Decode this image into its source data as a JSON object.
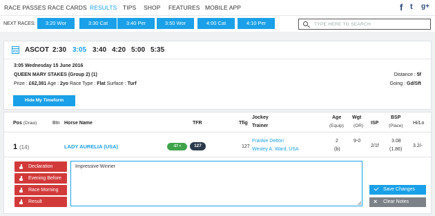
{
  "nav": {
    "items": [
      "RACE PASSES",
      "RACE CARDS",
      "RESULTS",
      "TIPS",
      "SHOP",
      "FEATURES",
      "MOBILE APP"
    ],
    "active": "RESULTS",
    "social": [
      "f",
      "t",
      "g+"
    ]
  },
  "next_races": {
    "label": "NEXT RACES:",
    "races": [
      "3:20 Wor",
      "3:30 Cat",
      "3:40 Per",
      "3:50 Wor",
      "4:00 Cat",
      "4:10 Per"
    ]
  },
  "search": {
    "placeholder": "TYPE HERE TO SEARCH"
  },
  "meeting": {
    "venue": "ASCOT",
    "times": [
      "2:30",
      "3:05",
      "3:40",
      "4:20",
      "5:00",
      "5:35"
    ],
    "active_time": "3:05"
  },
  "race": {
    "datetime": "3:05 Wednesday 15 June 2016",
    "name": "QUEEN MARY STAKES (Group 2) (1)",
    "prize_label": "Prize :",
    "prize": "£62,381",
    "age_label": "Age :",
    "age": "2yo",
    "type_label": "Race Type :",
    "type": "Flat",
    "surface_label": "Surface :",
    "surface": "Turf",
    "distance_label": "Distance :",
    "distance": "5f",
    "going_label": "Going :",
    "going": "Gd/Sft",
    "hide_button": "Hide My Timeform"
  },
  "table": {
    "headers": {
      "pos": "Pos",
      "pos_sub": "(Draw)",
      "btn": "Btn",
      "horse": "Horse Name",
      "tfr": "TFR",
      "tfig": "Tfig",
      "jockey": "Jockey",
      "trainer": "Trainer",
      "age": "Age",
      "age_sub": "(Equip)",
      "wgt": "Wgt",
      "wgt_sub": "(OR)",
      "isp": "ISP",
      "bsp": "BSP",
      "bsp_sub": "(Place)",
      "hilo": "Hi/Lo"
    },
    "runner": {
      "pos": "1",
      "draw": "(14)",
      "horse": "LADY AURELIA (USA)",
      "tfr_badge": "-57 <",
      "tfr": "127",
      "tfig": "127",
      "jockey": "Frankie Dettori",
      "trainer": "Wesley A. Ward, USA",
      "age": "2",
      "equip": "(b)",
      "wgt": "9-0",
      "isp": "2/1f",
      "bsp": "3.08",
      "bsp_place": "(1.86)",
      "hilo": "3.2/-"
    }
  },
  "notes": {
    "buttons": [
      "Declaration",
      "Evening Before",
      "Race Morning",
      "Result"
    ],
    "text": "Impressive Winner",
    "save": "Save Changes",
    "clear": "Clear Notes"
  },
  "colors": {
    "accent": "#1aa0e8",
    "red": "#d23a3a",
    "green": "#3fa34a",
    "dark": "#2a3a4a",
    "gray": "#7c8288"
  }
}
